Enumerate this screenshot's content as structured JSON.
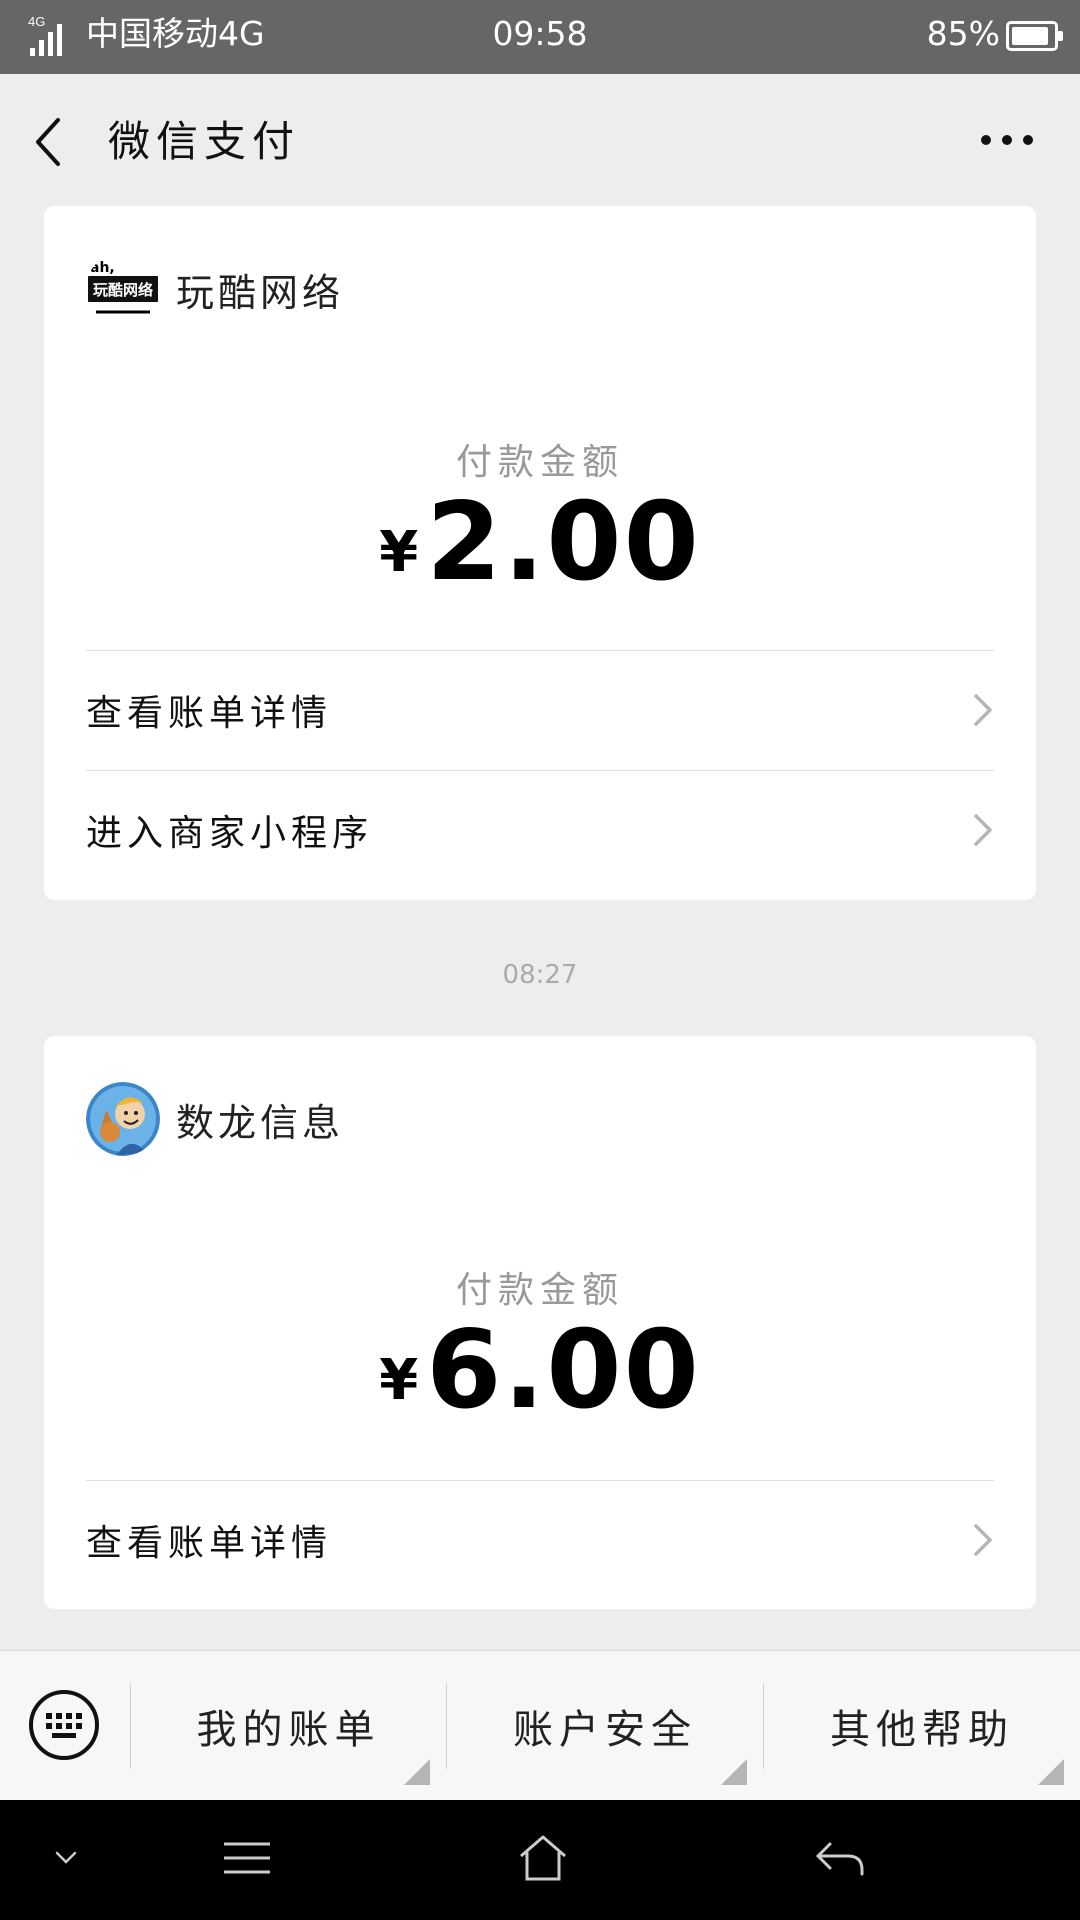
{
  "status_bar": {
    "network": "4G",
    "carrier": "中国移动4G",
    "time": "09:58",
    "battery": "85%"
  },
  "header": {
    "title": "微信支付",
    "back_icon": "chevron-left-icon",
    "more_icon": "more-dots-icon"
  },
  "payments": [
    {
      "merchant": "玩酷网络",
      "logo_text": "玩酷网络",
      "amount_label": "付款金额",
      "currency": "¥",
      "amount": "2.00",
      "actions": [
        "查看账单详情",
        "进入商家小程序"
      ]
    },
    {
      "merchant": "数龙信息",
      "amount_label": "付款金额",
      "currency": "¥",
      "amount": "6.00",
      "actions": [
        "查看账单详情"
      ]
    }
  ],
  "timestamp": "08:27",
  "menu": {
    "keyboard_icon": "keyboard-icon",
    "items": [
      "我的账单",
      "账户安全",
      "其他帮助"
    ]
  },
  "nav": {
    "icons": [
      "chevron-down-icon",
      "menu-icon",
      "home-icon",
      "back-icon"
    ]
  },
  "colors": {
    "status_bar_bg": "#666666",
    "page_bg": "#ededed",
    "card_bg": "#ffffff",
    "nav_bg": "#000000"
  }
}
